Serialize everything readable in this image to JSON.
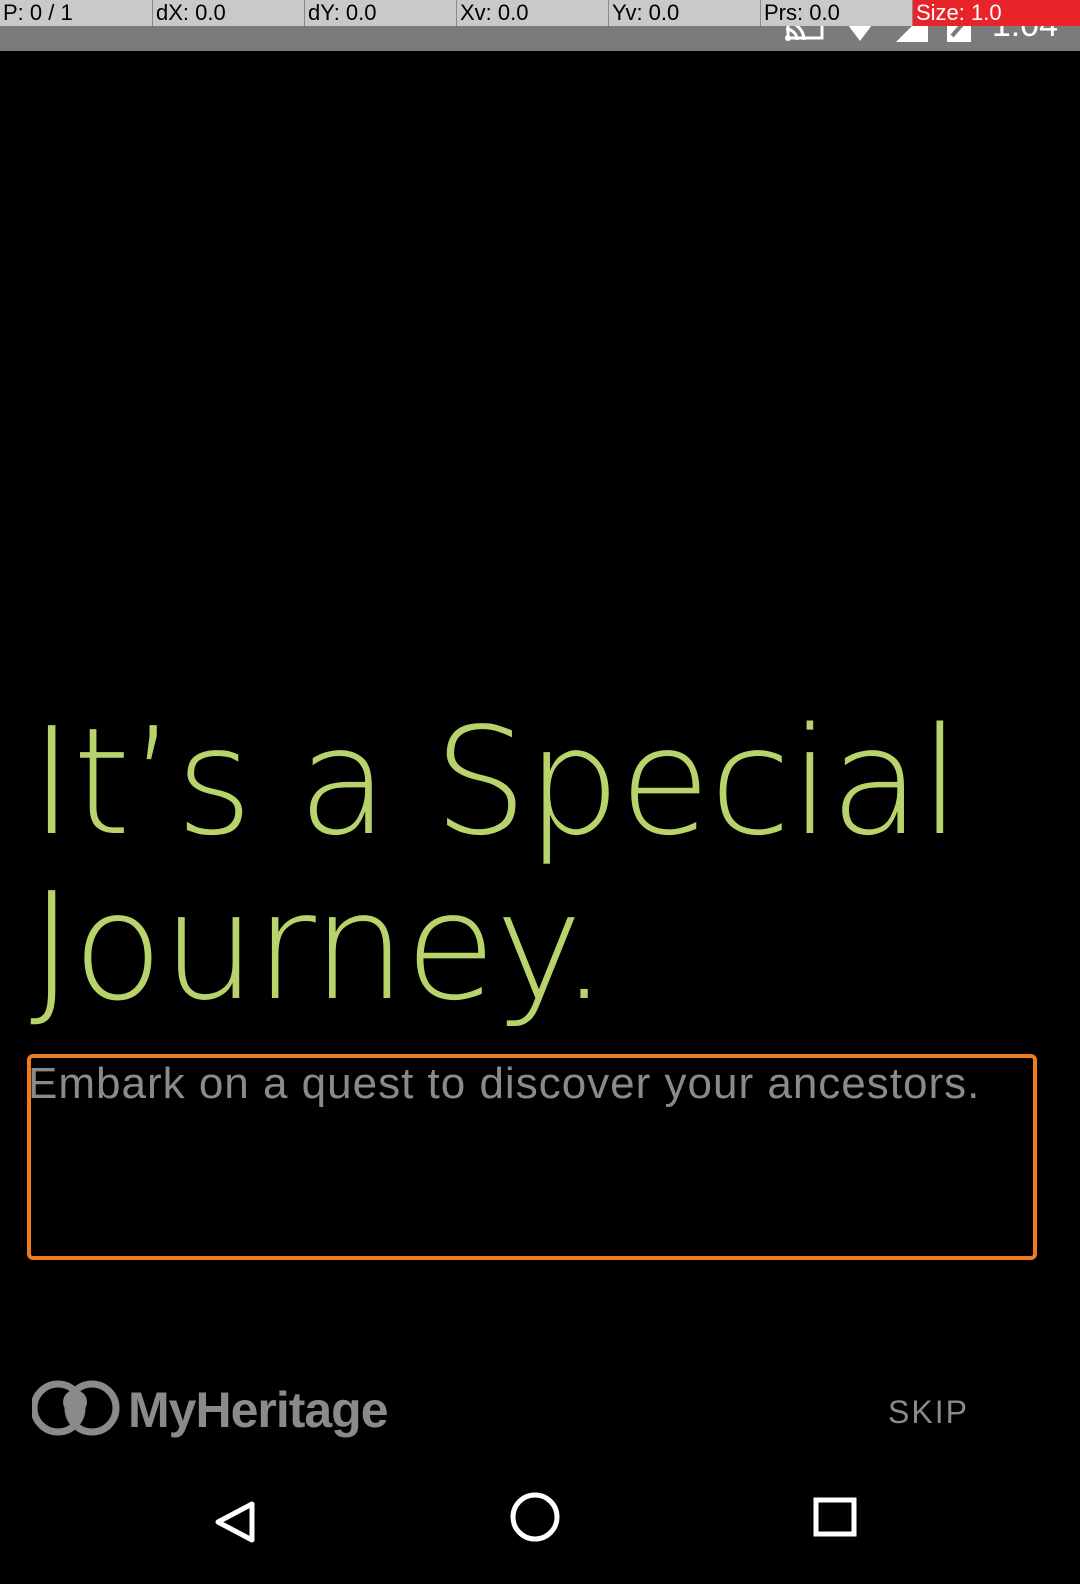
{
  "pointer_overlay": {
    "p": "P: 0 / 1",
    "dx": "dX: 0.0",
    "dy": "dY: 0.0",
    "xv": "Xv: 0.0",
    "yv": "Yv: 0.0",
    "prs": "Prs: 0.0",
    "size": "Size: 1.0"
  },
  "status_bar": {
    "time": "1:04",
    "icons": [
      "cast-icon",
      "wifi-icon",
      "signal-icon",
      "battery-icon"
    ]
  },
  "onboarding": {
    "headline": "It’s a Special Journey.",
    "description": "Embark on a quest to discover your ancestors.",
    "logo_text": "MyHeritage",
    "skip_label": "SKIP"
  },
  "colors": {
    "headline": "#b8d36b",
    "description": "#8a8a8a",
    "highlight_border": "#f07a1c"
  },
  "nav_bar": {
    "icons": [
      "back-icon",
      "home-icon",
      "recents-icon"
    ]
  }
}
